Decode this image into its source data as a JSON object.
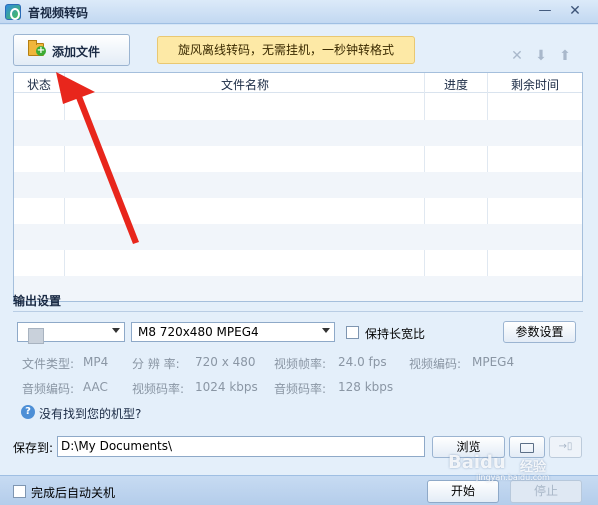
{
  "window": {
    "title": "音视频转码",
    "min_glyph": "—",
    "close_glyph": "✕"
  },
  "toolbar": {
    "add_file_label": "添加文件",
    "promo_text": "旋风离线转码，无需挂机，一秒钟转格式",
    "remove_icon": "x-icon",
    "move_down_icon": "arrow-down-icon",
    "move_up_icon": "arrow-up-icon",
    "remove_glyph": "✕",
    "down_glyph": "⬇",
    "up_glyph": "⬆"
  },
  "file_table": {
    "columns": [
      "状态",
      "文件名称",
      "进度",
      "剩余时间"
    ],
    "rows": []
  },
  "output": {
    "section_title": "输出设置",
    "format_value": "M8 720x480 MPEG4",
    "keep_ratio_label": "保持长宽比",
    "keep_ratio_checked": false,
    "param_button": "参数设置",
    "info": {
      "file_type_label": "文件类型:",
      "file_type_value": "MP4",
      "resolution_label": "分 辨 率:",
      "resolution_value": "720 x 480",
      "video_fps_label": "视频帧率:",
      "video_fps_value": "24.0 fps",
      "video_codec_label": "视频编码:",
      "video_codec_value": "MPEG4",
      "audio_codec_label": "音频编码:",
      "audio_codec_value": "AAC",
      "video_bitrate_label": "视频码率:",
      "video_bitrate_value": "1024 kbps",
      "audio_bitrate_label": "音频码率:",
      "audio_bitrate_value": "128 kbps"
    },
    "help_glyph": "?",
    "help_link": "没有找到您的机型?"
  },
  "save": {
    "label": "保存到:",
    "path": "D:\\My Documents\\",
    "browse_button": "浏览",
    "export_glyph": "→▯"
  },
  "bottom": {
    "shutdown_label": "完成后自动关机",
    "shutdown_checked": false,
    "start_button": "开始",
    "stop_button": "停止"
  },
  "watermark": {
    "text": "Baidu",
    "sub": "经验",
    "url": "jingyan.baidu.com"
  },
  "colors": {
    "accent_arrow": "#e8261c",
    "promo_bg": "#fde9a6",
    "window_bg": "#e4effa"
  }
}
